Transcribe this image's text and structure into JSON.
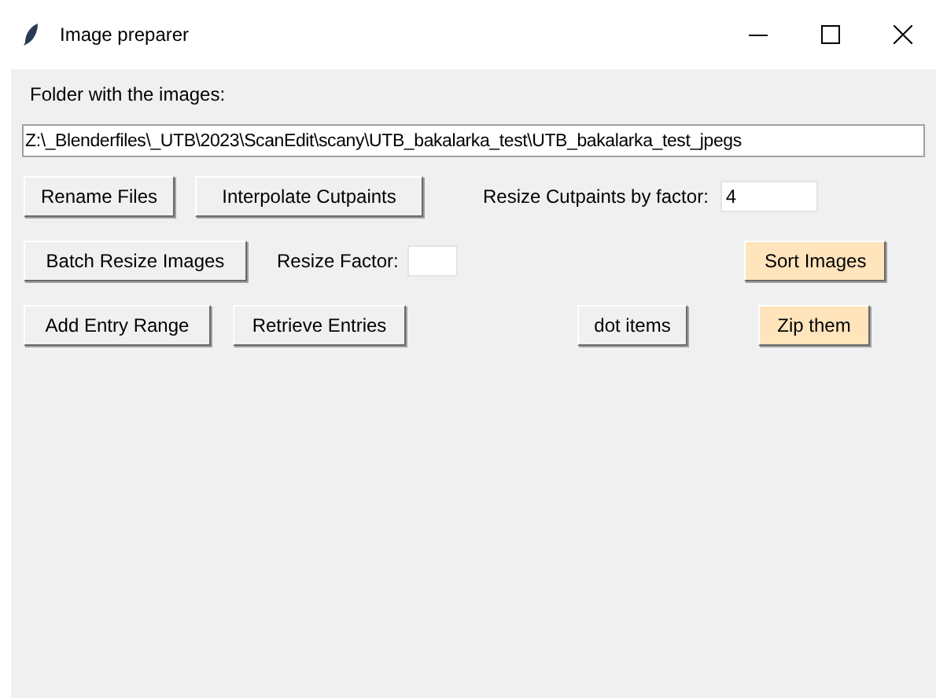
{
  "window": {
    "title": "Image preparer"
  },
  "folder": {
    "label": "Folder with the images:",
    "value": "Z:\\_Blenderfiles\\_UTB\\2023\\ScanEdit\\scany\\UTB_bakalarka_test\\UTB_bakalarka_test_jpegs"
  },
  "rows": [
    [
      {
        "kind": "button",
        "text": "Rename Files",
        "highlighted": false
      },
      {
        "kind": "button",
        "text": "Interpolate Cutpaints",
        "highlighted": false
      },
      {
        "kind": "label",
        "text": "Resize Cutpaints by factor:"
      },
      {
        "kind": "input",
        "value": "4"
      }
    ],
    [
      {
        "kind": "button",
        "text": "Batch Resize Images",
        "highlighted": false
      },
      {
        "kind": "label",
        "text": "Resize Factor:"
      },
      {
        "kind": "input"
      },
      {
        "kind": "button",
        "text": "Sort Images",
        "highlighted": true
      }
    ],
    [
      {
        "kind": "button",
        "text": "Add Entry Range",
        "highlighted": false
      },
      {
        "kind": "button",
        "text": "Retrieve Entries",
        "highlighted": false
      },
      {
        "kind": "button",
        "text": "dot items",
        "highlighted": false
      },
      {
        "kind": "button",
        "text": "Zip them",
        "highlighted": true
      }
    ]
  ]
}
